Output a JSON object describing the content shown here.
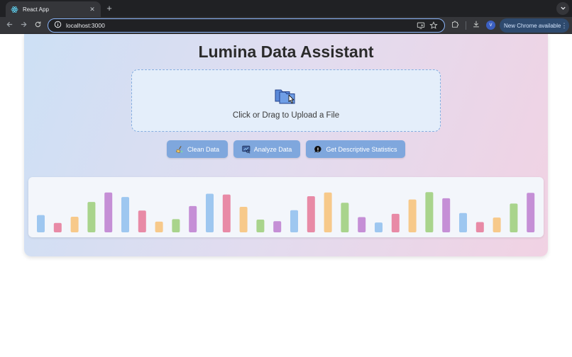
{
  "browser": {
    "tab_title": "React App",
    "tab_close": "✕",
    "new_tab": "+",
    "url": "localhost:3000",
    "profile_initial": "V",
    "update_label": "New Chrome available",
    "menu_glyph": "⋮"
  },
  "app": {
    "title": "Lumina Data Assistant",
    "upload_prompt": "Click or Drag to Upload a File",
    "buttons": [
      {
        "label": "Clean Data",
        "icon": "broom-icon"
      },
      {
        "label": "Analyze Data",
        "icon": "chart-analyze-icon"
      },
      {
        "label": "Get Descriptive Statistics",
        "icon": "info-bubble-icon"
      }
    ]
  },
  "colors": {
    "accent_button": "#7fa7dd",
    "upload_bg": "#e4eefa",
    "bar_palette": [
      "#9ec7f0",
      "#e88aa6",
      "#f7c98a",
      "#a9d48c",
      "#c58fd6"
    ]
  },
  "chart_data": {
    "type": "bar",
    "values": [
      0.42,
      0.23,
      0.38,
      0.74,
      0.97,
      0.86,
      0.53,
      0.26,
      0.32,
      0.64,
      0.94,
      0.92,
      0.62,
      0.31,
      0.27,
      0.54,
      0.88,
      0.97,
      0.72,
      0.37,
      0.24,
      0.45,
      0.8,
      0.98,
      0.83,
      0.47,
      0.25,
      0.36,
      0.7,
      0.96
    ],
    "colors": [
      "#9ec7f0",
      "#e88aa6",
      "#f7c98a",
      "#a9d48c",
      "#c58fd6",
      "#9ec7f0",
      "#e88aa6",
      "#f7c98a",
      "#a9d48c",
      "#c58fd6",
      "#9ec7f0",
      "#e88aa6",
      "#f7c98a",
      "#a9d48c",
      "#c58fd6",
      "#9ec7f0",
      "#e88aa6",
      "#f7c98a",
      "#a9d48c",
      "#c58fd6",
      "#9ec7f0",
      "#e88aa6",
      "#f7c98a",
      "#a9d48c",
      "#c58fd6",
      "#9ec7f0",
      "#e88aa6",
      "#f7c98a",
      "#a9d48c",
      "#c58fd6"
    ],
    "ylim": [
      0,
      1
    ],
    "grid": false,
    "legend": "none"
  }
}
